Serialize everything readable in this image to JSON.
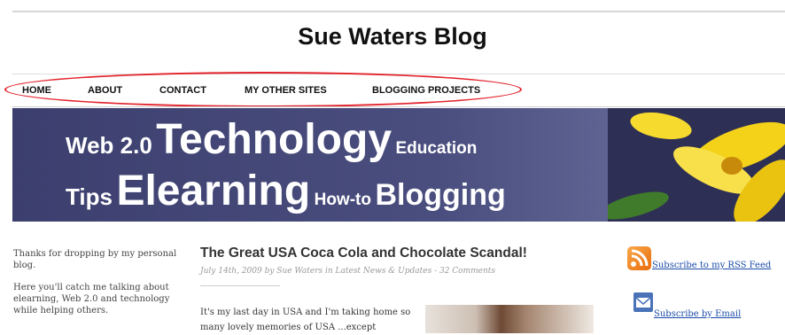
{
  "site": {
    "title": "Sue Waters Blog"
  },
  "nav": {
    "items": [
      {
        "label": "HOME"
      },
      {
        "label": "ABOUT"
      },
      {
        "label": "CONTACT"
      },
      {
        "label": "MY OTHER SITES"
      },
      {
        "label": "BLOGGING PROJECTS"
      }
    ],
    "highlight_color": "#e2232b"
  },
  "banner": {
    "line1": [
      "Web 2.0",
      "Technology",
      "Education"
    ],
    "line2": [
      "Tips",
      "Elearning",
      "How-to",
      "Blogging"
    ],
    "background": "#3c3f6e"
  },
  "sidebar": {
    "intro": "Thanks for dropping by my personal blog.",
    "desc": "Here you'll catch me talking about elearning, Web 2.0 and technology while helping others."
  },
  "post": {
    "title": "The Great USA Coca Cola and Chocolate Scandal!",
    "meta": "July 14th, 2009 by Sue Waters in Latest News & Updates - 32 Comments",
    "body": "It's my last day in USA and I'm taking home so many lovely memories of USA ...except"
  },
  "subscribe": {
    "rss_label": "Subscribe to my RSS Feed",
    "email_label": "Subscribe by Email",
    "rss_icon": "rss-icon",
    "email_icon": "mail-icon"
  }
}
